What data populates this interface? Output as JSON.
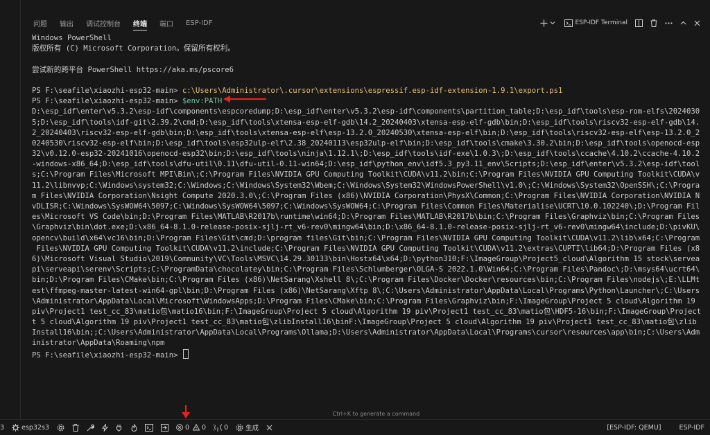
{
  "panel": {
    "tabs": [
      {
        "label": "问题"
      },
      {
        "label": "输出"
      },
      {
        "label": "调试控制台"
      },
      {
        "label": "终端"
      },
      {
        "label": "端口"
      },
      {
        "label": "ESP-IDF"
      }
    ],
    "active_tab": "终端",
    "terminal_name": "ESP-IDF Terminal"
  },
  "terminal": {
    "header_lines": [
      "Windows PowerShell",
      "版权所有 (C) Microsoft Corporation。保留所有权利。",
      "",
      "尝试新的跨平台 PowerShell https://aka.ms/pscore6",
      ""
    ],
    "prompt": "PS F:\\seafile\\xiaozhi-esp32-main> ",
    "command1": "c:\\Users\\Administrator\\.cursor\\extensions\\espressif.esp-idf-extension-1.9.1\\export.ps1",
    "command2": "$env:PATH",
    "output_lines": [
      "D:\\esp_idf\\enter\\v5.3.2\\esp-idf\\components\\espcoredump;D:\\esp_idf\\enter\\v5.3.2\\esp-idf\\components\\partition_table;D:\\esp_idf\\tools\\esp-rom-elfs\\2024030",
      "5;D:\\esp_idf\\tools\\idf-git\\2.39.2\\cmd;D:\\esp_idf\\tools\\xtensa-esp-elf-gdb\\14.2_20240403\\xtensa-esp-elf-gdb\\bin;D:\\esp_idf\\tools\\riscv32-esp-elf-gdb\\14.",
      "2_20240403\\riscv32-esp-elf-gdb\\bin;D:\\esp_idf\\tools\\xtensa-esp-elf\\esp-13.2.0_20240530\\xtensa-esp-elf\\bin;D:\\esp_idf\\tools\\riscv32-esp-elf\\esp-13.2.0_2",
      "0240530\\riscv32-esp-elf\\bin;D:\\esp_idf\\tools\\esp32ulp-elf\\2.38_20240113\\esp32ulp-elf\\bin;D:\\esp_idf\\tools\\cmake\\3.30.2\\bin;D:\\esp_idf\\tools\\openocd-esp",
      "32\\v0.12.0-esp32-20241016\\openocd-esp32\\bin;D:\\esp_idf\\tools\\ninja\\1.12.1\\;D:\\esp_idf\\tools\\idf-exe\\1.0.3\\;D:\\esp_idf\\tools\\ccache\\4.10.2\\ccache-4.10.2",
      "-windows-x86_64;D:\\esp_idf\\tools\\dfu-util\\0.11\\dfu-util-0.11-win64;D:\\esp_idf\\python_env\\idf5.3_py3.11_env\\Scripts;D:\\esp_idf\\enter\\v5.3.2\\esp-idf\\tool",
      "s;C:\\Program Files\\Microsoft MPI\\Bin\\;C:\\Program Files\\NVIDIA GPU Computing Toolkit\\CUDA\\v11.2\\bin;C:\\Program Files\\NVIDIA GPU Computing Toolkit\\CUDA\\v",
      "11.2\\libnvvp;C:\\Windows\\system32;C:\\Windows;C:\\Windows\\System32\\Wbem;C:\\Windows\\System32\\WindowsPowerShell\\v1.0\\;C:\\Windows\\System32\\OpenSSH\\;C:\\Progra",
      "m Files\\NVIDIA Corporation\\Nsight Compute 2020.3.0\\;C:\\Program Files (x86)\\NVIDIA Corporation\\PhysX\\Common;C:\\Program Files\\NVIDIA Corporation\\NVIDIA N",
      "vDLISR;C:\\Windows\\SysWOW64\\5097;C:\\Windows\\SysWOW64\\5097;C:\\Windows\\SysWOW64;C:\\Program Files\\Common Files\\Materialise\\UCRT\\10.0.102240\\;D:\\Program Fil",
      "es\\Microsoft VS Code\\bin;D:\\Program Files\\MATLAB\\R2017b\\runtime\\win64;D:\\Program Files\\MATLAB\\R2017b\\bin;C:\\Program Files\\Graphviz\\bin;C:\\Program Files",
      "\\Graphviz\\bin\\dot.exe;D:\\x86_64-8.1.0-release-posix-sjlj-rt_v6-rev0\\mingw64\\bin;D:\\x86_64-8.1.0-release-posix-sjlj-rt_v6-rev0\\mingw64\\include;D:\\pivKU\\",
      "opencv\\build\\x64\\vc16\\bin;D:\\Program Files\\Git\\cmd;D:\\program files\\Git\\bin;C:\\Program Files\\NVIDIA GPU Computing Toolkit\\CUDA\\v11.2\\lib\\x64;C:\\Program",
      " Files\\NVIDIA GPU Computing Toolkit\\CUDA\\v11.2\\include;C:\\Program Files\\NVIDIA GPU Computing Toolkit\\CUDA\\v11.2\\extras\\CUPTI\\lib64;D:\\Program Files (x8",
      "6)\\Microsoft Visual Studio\\2019\\Community\\VC\\Tools\\MSVC\\14.29.30133\\bin\\Hostx64\\x64;D:\\python310;F:\\ImageGroup\\Project5_cloud\\Algorithm 15 stock\\servea",
      "pi\\serveapi\\serenv\\Scripts;C:\\ProgramData\\chocolatey\\bin;C:\\Program Files\\Schlumberger\\OLGA-S 2022.1.0\\Win64;C:\\Program Files\\Pandoc\\;D:\\msys64\\ucrt64\\",
      "bin;D:\\Program Files\\CMake\\bin;C:\\Program Files (x86)\\NetSarang\\Xshell 8\\;C:\\Program Files\\Docker\\Docker\\resources\\bin;C:\\Program Files\\nodejs\\;E:\\LLMt",
      "est\\ffmpeg-master-latest-win64-gpl\\bin;D:\\Program Files (x86)\\NetSarang\\Xftp 8\\;C:\\Users\\Administrator\\AppData\\Local\\Programs\\Python\\Launcher\\;C:\\Users",
      "\\Administrator\\AppData\\Local\\Microsoft\\WindowsApps;D:\\Program Files\\CMake\\bin;C:\\Program Files\\Graphviz\\bin;F:\\ImageGroup\\Project 5 cloud\\Algorithm 19",
      "piv\\Project1 test_cc_83\\matio包\\matio16\\bin;F:\\ImageGroup\\Project 5 cloud\\Algorithm 19 piv\\Project1 test_cc_83\\matio包\\HDF5-16\\bin;F:\\ImageGroup\\Project",
      "t 5 cloud\\Algorithm 19 piv\\Project1 test_cc_83\\matio包\\zlibInstall16\\binF:\\ImageGroup\\Project 5 cloud\\Algorithm 19 piv\\Project1 test_cc_83\\matio包\\zlib",
      "Install16\\bin;;C:\\Users\\Administrator\\AppData\\Local\\Programs\\Ollama;D:\\Users\\Administrator\\AppData\\Local\\Programs\\cursor\\resources\\app\\bin;C:\\Users\\Adm",
      "inistrator\\AppData\\Roaming\\npm"
    ]
  },
  "hint": "Ctrl+K to generate a command",
  "statusbar": {
    "left_fragment": "3",
    "chip": "esp32s3",
    "errors": "0",
    "warnings": "0",
    "antenna_count": "0",
    "build_label": "生成",
    "right_qemu": "[ESP-IDF: QEMU]",
    "right_esp": "ESP-IDF"
  },
  "colors": {
    "background": "#181818",
    "command": "#e5c07b",
    "variable": "#6ec19a",
    "arrow": "#e5211f"
  }
}
